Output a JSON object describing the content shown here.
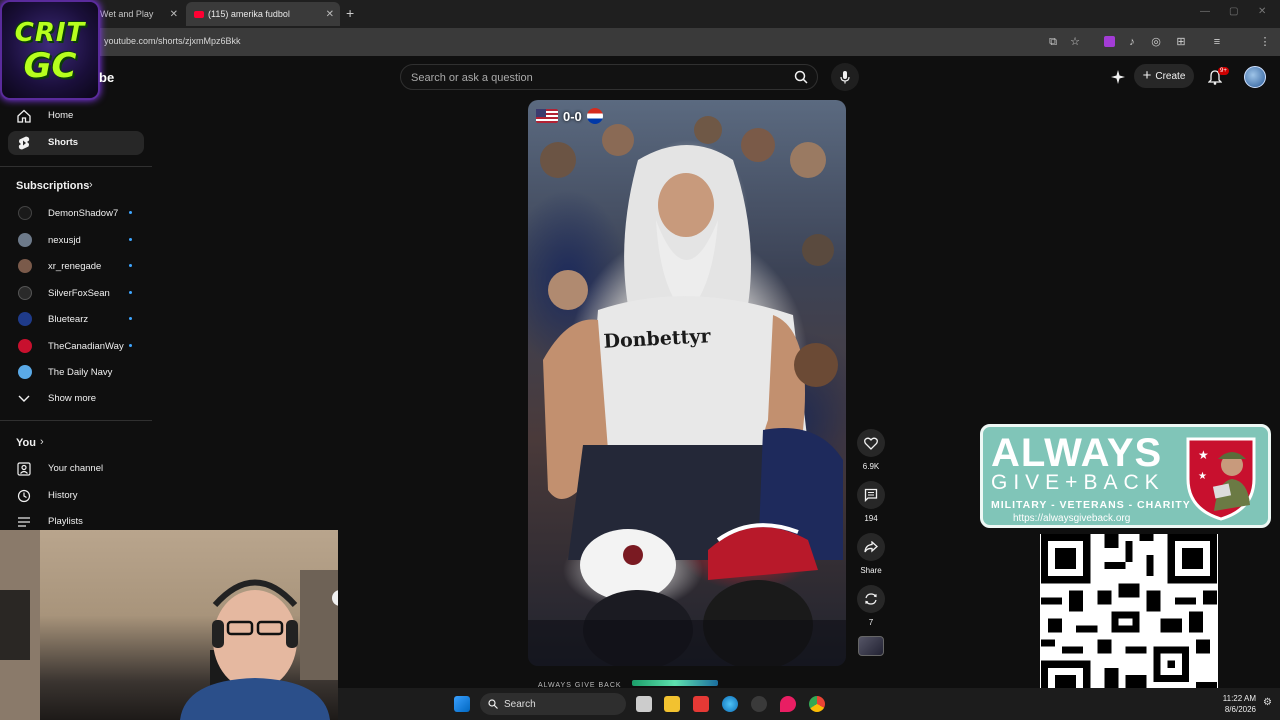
{
  "browser": {
    "tabs": [
      {
        "title": "Wet and Play"
      },
      {
        "title": "(115) amerika fudbol"
      }
    ],
    "url": "youtube.com/shorts/zjxmMpz6Bkk"
  },
  "logo": {
    "line1": "CRIT",
    "line2": "GC"
  },
  "youtube": {
    "wordmark": "be",
    "search_placeholder": "Search or ask a question",
    "create_label": "Create",
    "notifications_badge": "9+"
  },
  "sidebar": {
    "nav": [
      {
        "label": "Home",
        "icon": "home-icon"
      },
      {
        "label": "Shorts",
        "icon": "shorts-icon"
      }
    ],
    "subscriptions_heading": "Subscriptions",
    "subscriptions": [
      {
        "name": "DemonShadow7",
        "color": "#1a1a1a"
      },
      {
        "name": "nexusjd",
        "color": "#6d7a8a"
      },
      {
        "name": "xr_renegade",
        "color": "#7a5a4a"
      },
      {
        "name": "SilverFoxSean",
        "color": "#2a2a2a"
      },
      {
        "name": "Bluetearz",
        "color": "#1f3b8a"
      },
      {
        "name": "TheCanadianWay",
        "color": "#c8102e"
      },
      {
        "name": "The Daily Navy",
        "color": "#5aa9e6"
      }
    ],
    "show_more": "Show more",
    "you_heading": "You",
    "you_items": [
      {
        "label": "Your channel",
        "icon": "channel-icon"
      },
      {
        "label": "History",
        "icon": "history-icon"
      },
      {
        "label": "Playlists",
        "icon": "playlists-icon"
      }
    ]
  },
  "short": {
    "score": "0-0",
    "shirt_text": "Donbettyr",
    "bottom_text": "ALWAYS GIVE BACK"
  },
  "actions": {
    "likes": "6.9K",
    "comments": "194",
    "share": "Share",
    "remix": "7"
  },
  "sponsor": {
    "line1": "ALWAYS",
    "line2": "GIVE+BACK",
    "line3": "MILITARY - VETERANS - CHARITY",
    "url": "https://alwaysgiveback.org"
  },
  "taskbar": {
    "search_label": "Search",
    "time": "11:22 AM",
    "date": "8/6/2026"
  },
  "colors": {
    "accent_red": "#ff0033",
    "sponsor_teal": "#80c5b8",
    "link_blue": "#3ea6ff"
  }
}
